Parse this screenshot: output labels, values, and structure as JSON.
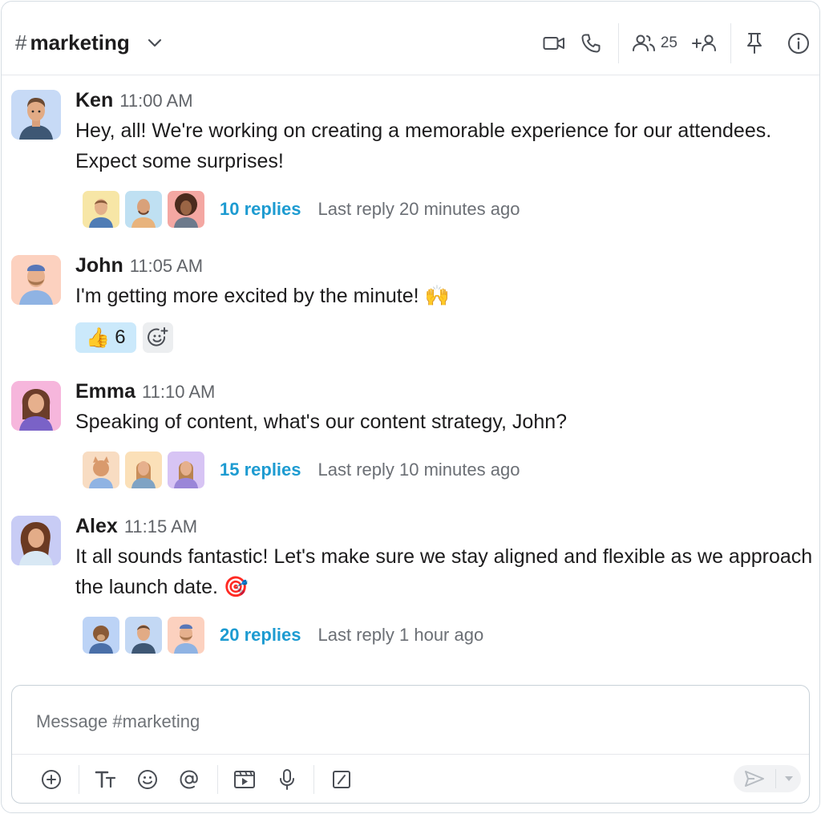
{
  "header": {
    "channel_hash": "#",
    "channel_name": "marketing",
    "member_count": "25",
    "icons": [
      "video-camera-icon",
      "phone-icon",
      "members-icon",
      "add-member-icon",
      "pin-icon",
      "info-icon"
    ]
  },
  "messages": [
    {
      "author": "Ken",
      "time": "11:00 AM",
      "text": "Hey, all! We're working on creating a memorable experience for our attendees. Expect some surprises!",
      "thread": {
        "replies": "10 replies",
        "last_reply": "Last reply 20 minutes ago"
      }
    },
    {
      "author": "John",
      "time": "11:05 AM",
      "text": "I'm getting more excited by the minute! 🙌",
      "reaction": {
        "emoji": "👍",
        "count": "6"
      }
    },
    {
      "author": "Emma",
      "time": "11:10 AM",
      "text": "Speaking of content, what's our content strategy, John?",
      "thread": {
        "replies": "15 replies",
        "last_reply": "Last reply 10 minutes ago"
      }
    },
    {
      "author": "Alex",
      "time": "11:15 AM",
      "text": "It all sounds fantastic! Let's make sure we stay aligned and flexible as we approach the launch date. 🎯",
      "thread": {
        "replies": "20 replies",
        "last_reply": "Last reply 1 hour ago"
      }
    }
  ],
  "composer": {
    "placeholder": "Message #marketing",
    "tools": [
      "plus-circle-icon",
      "text-format-icon",
      "emoji-icon",
      "mention-icon",
      "video-clip-icon",
      "microphone-icon",
      "slash-command-icon",
      "send-icon",
      "chevron-down-icon"
    ]
  },
  "colors": {
    "link": "#1d9bd1",
    "reaction_bg": "#cbe9fb",
    "border": "#d6dde3"
  }
}
